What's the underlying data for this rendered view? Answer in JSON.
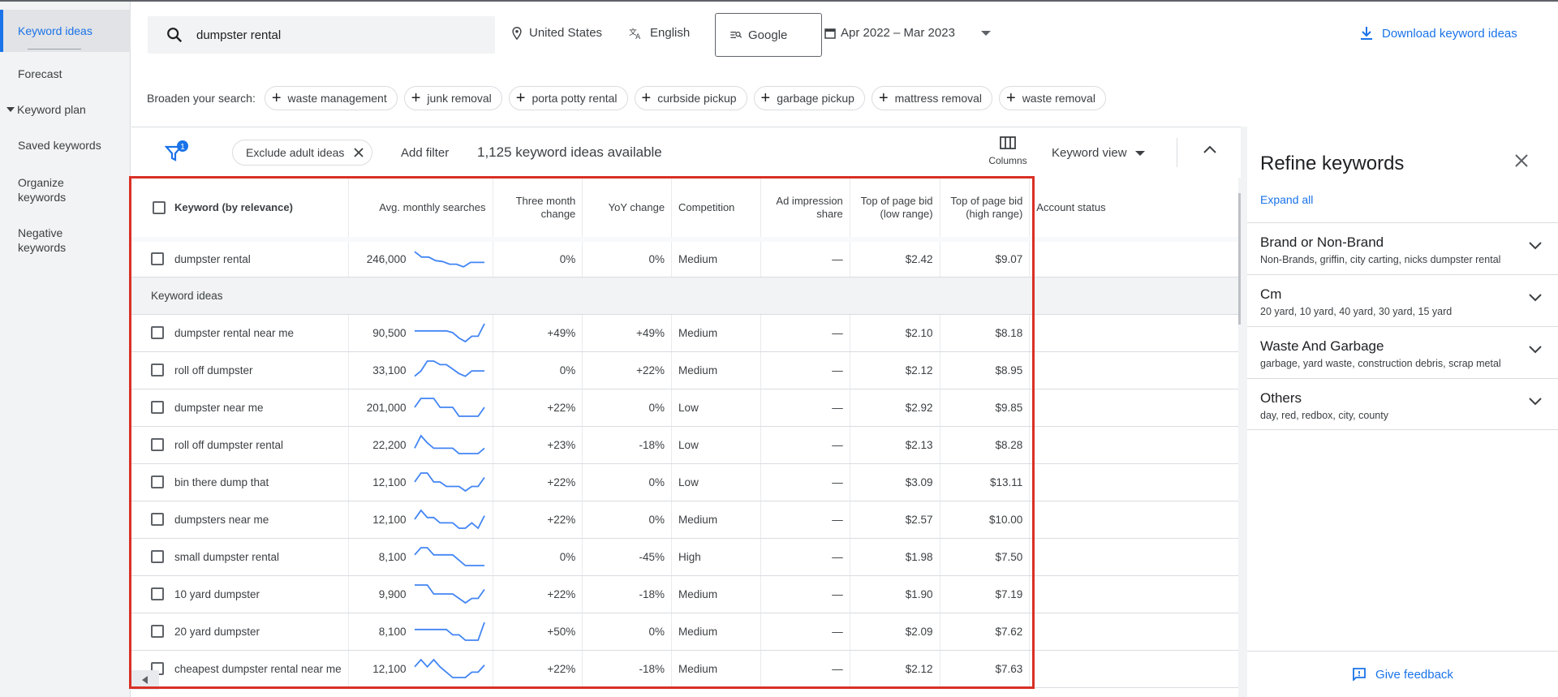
{
  "sidebar": {
    "items": [
      {
        "label": "Keyword ideas"
      },
      {
        "label": "Forecast"
      },
      {
        "label": "Keyword plan"
      },
      {
        "label": "Saved keywords"
      },
      {
        "label": "Organize keywords"
      },
      {
        "label": "Negative keywords"
      }
    ]
  },
  "topbar": {
    "search_value": "dumpster rental",
    "location": "United States",
    "language": "English",
    "engine": "Google",
    "date_range": "Apr 2022 – Mar 2023",
    "download_label": "Download keyword ideas"
  },
  "broaden": {
    "label": "Broaden your search:",
    "chips": [
      "waste management",
      "junk removal",
      "porta potty rental",
      "curbside pickup",
      "garbage pickup",
      "mattress removal",
      "waste removal"
    ]
  },
  "filters": {
    "badge_count": "1",
    "exclude_label": "Exclude adult ideas",
    "add_filter": "Add filter",
    "available": "1,125 keyword ideas available",
    "columns_label": "Columns",
    "view_label": "Keyword view"
  },
  "table": {
    "headers": {
      "keyword": "Keyword (by relevance)",
      "avg": "Avg. monthly searches",
      "three_month": "Three month change",
      "yoy": "YoY change",
      "competition": "Competition",
      "ad_share": "Ad impression share",
      "bid_low": "Top of page bid (low range)",
      "bid_high": "Top of page bid (high range)",
      "account": "Account status"
    },
    "section_label": "Keyword ideas",
    "rows": [
      {
        "keyword": "dumpster rental",
        "avg": "246,000",
        "three_month": "0%",
        "yoy": "0%",
        "competition": "Medium",
        "ad_share": "—",
        "bid_low": "$2.42",
        "bid_high": "$9.07",
        "trend": [
          0.9,
          0.6,
          0.6,
          0.4,
          0.35,
          0.2,
          0.2,
          0.05,
          0.3,
          0.3,
          0.3
        ]
      },
      {
        "keyword": "dumpster rental near me",
        "avg": "90,500",
        "three_month": "+49%",
        "yoy": "+49%",
        "competition": "Medium",
        "ad_share": "—",
        "bid_low": "$2.10",
        "bid_high": "$8.18",
        "trend": [
          0.6,
          0.6,
          0.6,
          0.6,
          0.6,
          0.6,
          0.5,
          0.2,
          0.0,
          0.3,
          0.3,
          1.0
        ]
      },
      {
        "keyword": "roll off dumpster",
        "avg": "33,100",
        "three_month": "0%",
        "yoy": "+22%",
        "competition": "Medium",
        "ad_share": "—",
        "bid_low": "$2.12",
        "bid_high": "$8.95",
        "trend": [
          0.15,
          0.45,
          1.0,
          1.0,
          0.8,
          0.8,
          0.55,
          0.3,
          0.15,
          0.45,
          0.45,
          0.45
        ]
      },
      {
        "keyword": "dumpster near me",
        "avg": "201,000",
        "three_month": "+22%",
        "yoy": "0%",
        "competition": "Low",
        "ad_share": "—",
        "bid_low": "$2.92",
        "bid_high": "$9.85",
        "trend": [
          0.5,
          1.0,
          1.0,
          1.0,
          0.5,
          0.5,
          0.5,
          0.0,
          0.0,
          0.0,
          0.0,
          0.5
        ]
      },
      {
        "keyword": "roll off dumpster rental",
        "avg": "22,200",
        "three_month": "+23%",
        "yoy": "-18%",
        "competition": "Low",
        "ad_share": "—",
        "bid_low": "$2.13",
        "bid_high": "$8.28",
        "trend": [
          0.3,
          1.0,
          0.6,
          0.3,
          0.3,
          0.3,
          0.3,
          0.0,
          0.0,
          0.0,
          0.0,
          0.3
        ]
      },
      {
        "keyword": "bin there dump that",
        "avg": "12,100",
        "three_month": "+22%",
        "yoy": "0%",
        "competition": "Low",
        "ad_share": "—",
        "bid_low": "$3.09",
        "bid_high": "$13.11",
        "trend": [
          0.5,
          1.0,
          1.0,
          0.5,
          0.5,
          0.25,
          0.25,
          0.25,
          0.0,
          0.25,
          0.25,
          0.75
        ]
      },
      {
        "keyword": "dumpsters near me",
        "avg": "12,100",
        "three_month": "+22%",
        "yoy": "0%",
        "competition": "Medium",
        "ad_share": "—",
        "bid_low": "$2.57",
        "bid_high": "$10.00",
        "trend": [
          0.5,
          1.0,
          0.6,
          0.6,
          0.3,
          0.3,
          0.3,
          0.0,
          0.0,
          0.3,
          0.0,
          0.7
        ]
      },
      {
        "keyword": "small dumpster rental",
        "avg": "8,100",
        "three_month": "0%",
        "yoy": "-45%",
        "competition": "High",
        "ad_share": "—",
        "bid_low": "$1.98",
        "bid_high": "$7.50",
        "trend": [
          0.6,
          1.0,
          1.0,
          0.6,
          0.6,
          0.6,
          0.6,
          0.3,
          0.0,
          0.0,
          0.0,
          0.0
        ]
      },
      {
        "keyword": "10 yard dumpster",
        "avg": "9,900",
        "three_month": "+22%",
        "yoy": "-18%",
        "competition": "Medium",
        "ad_share": "—",
        "bid_low": "$1.90",
        "bid_high": "$7.19",
        "trend": [
          1.0,
          1.0,
          1.0,
          0.5,
          0.5,
          0.5,
          0.5,
          0.25,
          0.0,
          0.25,
          0.25,
          0.75
        ]
      },
      {
        "keyword": "20 yard dumpster",
        "avg": "8,100",
        "three_month": "+50%",
        "yoy": "0%",
        "competition": "Medium",
        "ad_share": "—",
        "bid_low": "$2.09",
        "bid_high": "$7.62",
        "trend": [
          0.6,
          0.6,
          0.6,
          0.6,
          0.6,
          0.6,
          0.3,
          0.3,
          0.0,
          0.0,
          0.0,
          1.0
        ]
      },
      {
        "keyword": "cheapest dumpster rental near me",
        "avg": "12,100",
        "three_month": "+22%",
        "yoy": "-18%",
        "competition": "Medium",
        "ad_share": "—",
        "bid_low": "$2.12",
        "bid_high": "$7.63",
        "trend": [
          0.6,
          1.0,
          0.6,
          1.0,
          0.6,
          0.3,
          0.0,
          0.0,
          0.0,
          0.3,
          0.3,
          0.7
        ]
      }
    ]
  },
  "refine": {
    "title": "Refine keywords",
    "expand_all": "Expand all",
    "sections": [
      {
        "title": "Brand or Non-Brand",
        "subtitle": "Non-Brands, griffin, city carting, nicks dumpster rental"
      },
      {
        "title": "Cm",
        "subtitle": "20 yard, 10 yard, 40 yard, 30 yard, 15 yard"
      },
      {
        "title": "Waste And Garbage",
        "subtitle": "garbage, yard waste, construction debris, scrap metal"
      },
      {
        "title": "Others",
        "subtitle": "day, red, redbox, city, county"
      }
    ],
    "feedback": "Give feedback"
  },
  "colors": {
    "accent": "#1a73e8",
    "highlight": "#d93025",
    "sparkline": "#4285f4"
  }
}
